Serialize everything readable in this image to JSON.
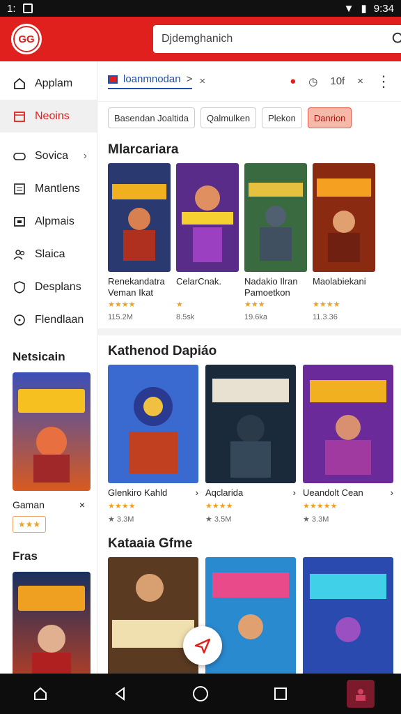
{
  "status": {
    "left": "1:",
    "time": "9:34"
  },
  "appbar": {
    "logo_text": "GG",
    "search_value": "Djdemghanich",
    "alert": "!"
  },
  "sidebar": {
    "items": [
      {
        "label": "Applam",
        "icon": "home-icon"
      },
      {
        "label": "Neoins",
        "icon": "calendar-icon"
      },
      {
        "label": "Sovica",
        "icon": "gamepad-icon"
      },
      {
        "label": "Mantlens",
        "icon": "list-icon"
      },
      {
        "label": "Alpmais",
        "icon": "wallet-icon"
      },
      {
        "label": "Slaica",
        "icon": "users-icon"
      },
      {
        "label": "Desplans",
        "icon": "shield-icon"
      },
      {
        "label": "Flendlaan",
        "icon": "clock-icon"
      }
    ],
    "section1": "Netsicain",
    "card1_label": "Gaman",
    "card1_rating": "★★★",
    "section2": "Fras"
  },
  "tabs": {
    "active": "loanmnodan",
    "arrow": ">",
    "tab_x": "×",
    "tab2_label": "10f",
    "tab2_close": "×"
  },
  "chips": [
    "Basendan Joaltida",
    "Qalmulken",
    "Plekon",
    "Danrion"
  ],
  "section1": {
    "title": "Mlarcariara",
    "cards": [
      {
        "title": "Renekandatra Veman Ikat",
        "stars": "★★★★",
        "meta": "115.2M"
      },
      {
        "title": "CelarCnak.",
        "stars": "★",
        "meta": "8.5sk"
      },
      {
        "title": "Nadakio Ilran Pamoetkon",
        "stars": "★★★",
        "meta": "19.6ka"
      },
      {
        "title": "Maolabiekani",
        "stars": "★★★★",
        "meta": "11.3.36"
      }
    ]
  },
  "section2": {
    "title": "Kathenod Dapiáo",
    "cards": [
      {
        "title": "Glenkiro Kahld",
        "stars": "★★★★",
        "meta": "★ 3.3M"
      },
      {
        "title": "Aqclarida",
        "stars": "★★★★",
        "meta": "★ 3.5M"
      },
      {
        "title": "Ueandolt Cean",
        "stars": "★★★★★",
        "meta": "★ 3.3M"
      }
    ]
  },
  "section3": {
    "title": "Kataaia Gfme"
  },
  "colors": {
    "brand": "#e0201c",
    "star": "#f0a020",
    "link": "#1a4fb0"
  }
}
